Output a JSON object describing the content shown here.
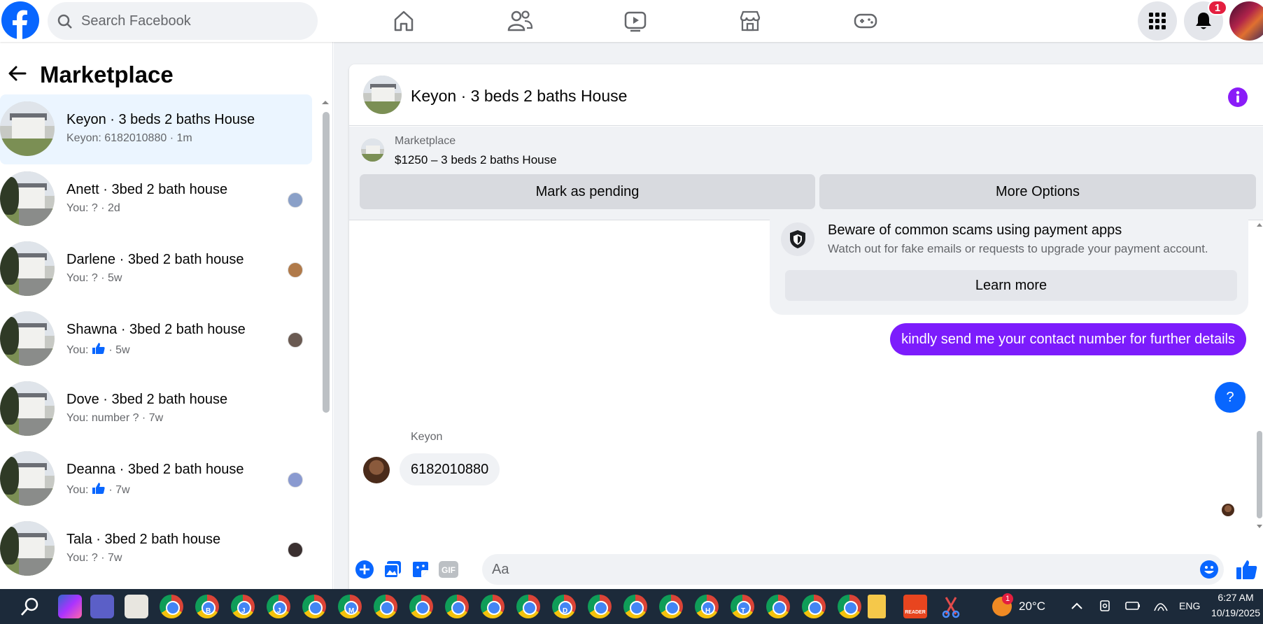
{
  "topbar": {
    "search_placeholder": "Search Facebook",
    "notification_count": "1",
    "nav_icons": [
      "home-icon",
      "friends-icon",
      "watch-icon",
      "marketplace-icon",
      "gaming-icon"
    ],
    "brand_color": "#0866ff"
  },
  "sidebar": {
    "title": "Marketplace",
    "conversations": [
      {
        "title": "Keyon · 3 beds 2 baths House",
        "subtitle": "Keyon: 6182010880 · 1m",
        "active": true
      },
      {
        "title": "Anett · 3bed 2 bath house",
        "subtitle": "You: ? · 2d"
      },
      {
        "title": "Darlene · 3bed 2 bath house",
        "subtitle": "You: ? · 5w"
      },
      {
        "title": "Shawna · 3bed 2 bath house",
        "subtitle_prefix": "You:",
        "subtitle_suffix": "· 5w"
      },
      {
        "title": "Dove · 3bed 2 bath house",
        "subtitle": "You: number ? · 7w"
      },
      {
        "title": "Deanna · 3bed 2 bath house",
        "subtitle_prefix": "You:",
        "subtitle_suffix": "· 7w"
      },
      {
        "title": "Tala · 3bed 2 bath house",
        "subtitle": "You: ? · 7w"
      }
    ]
  },
  "chat": {
    "title": "Keyon · 3 beds 2 baths House",
    "listing": {
      "source": "Marketplace",
      "price_title": "$1250 – 3 beds 2 baths House",
      "mark_pending_label": "Mark as pending",
      "more_options_label": "More Options"
    },
    "scam_notice": {
      "title": "Beware of common scams using payment apps",
      "description": "Watch out for fake emails or requests to upgrade your payment account.",
      "learn_more_label": "Learn more"
    },
    "outgoing_message": "kindly send me your contact number for further details",
    "help_label": "?",
    "incoming": {
      "sender": "Keyon",
      "message": "6182010880"
    },
    "composer_placeholder": "Aa",
    "accent_color": "#7c1cfc"
  },
  "taskbar": {
    "temperature": "20°C",
    "language": "ENG",
    "time": "6:27 AM",
    "date": "10/19/2025",
    "weather_badge": "1",
    "app_letters": [
      "",
      "B",
      "J",
      "J",
      "",
      "M",
      "",
      "",
      "",
      "",
      "",
      "D",
      "",
      "",
      "",
      "H",
      "T",
      "",
      "",
      ""
    ],
    "reader_label": "READER"
  }
}
